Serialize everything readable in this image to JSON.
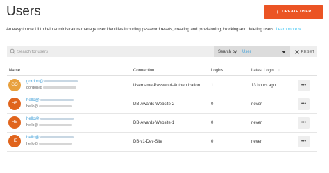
{
  "header": {
    "title": "Users",
    "create_button": {
      "icon": "plus-icon",
      "label": "CREATE USER",
      "color": "#eb5424"
    }
  },
  "intro": {
    "text": "An easy to use UI to help administrators manage user identities including password resets, creating and provisioning, blocking and deleting users.",
    "link": "Learn more »"
  },
  "search": {
    "placeholder": "Search for users",
    "search_by_label": "Search by",
    "search_by_value": "User",
    "reset_label": "RESET"
  },
  "table": {
    "columns": {
      "name": "Name",
      "connection": "Connection",
      "logins": "Logins",
      "latest_login": "Latest Login"
    },
    "rows": [
      {
        "initials": "GO",
        "avatar_color": "#e8a03d",
        "email_prefix": "gordon@",
        "email2_prefix": "gordon@",
        "connection": "Username-Password-Authentication",
        "logins": "1",
        "latest_login": "13 hours ago",
        "more": "•••"
      },
      {
        "initials": "HE",
        "avatar_color": "#e0641c",
        "email_prefix": "hello@",
        "email2_prefix": "hello@",
        "connection": "DB-Awards-Website-2",
        "logins": "0",
        "latest_login": "never",
        "more": "•••"
      },
      {
        "initials": "HE",
        "avatar_color": "#e0641c",
        "email_prefix": "hello@",
        "email2_prefix": "hello@",
        "connection": "DB-Awards-Website-1",
        "logins": "0",
        "latest_login": "never",
        "more": "•••"
      },
      {
        "initials": "HE",
        "avatar_color": "#e0641c",
        "email_prefix": "hello@",
        "email2_prefix": "hello@",
        "connection": "DB-v1-Dev-Site",
        "logins": "0",
        "latest_login": "never",
        "more": "•••"
      }
    ]
  },
  "colors": {
    "accent": "#eb5424",
    "link": "#44a1d8"
  }
}
